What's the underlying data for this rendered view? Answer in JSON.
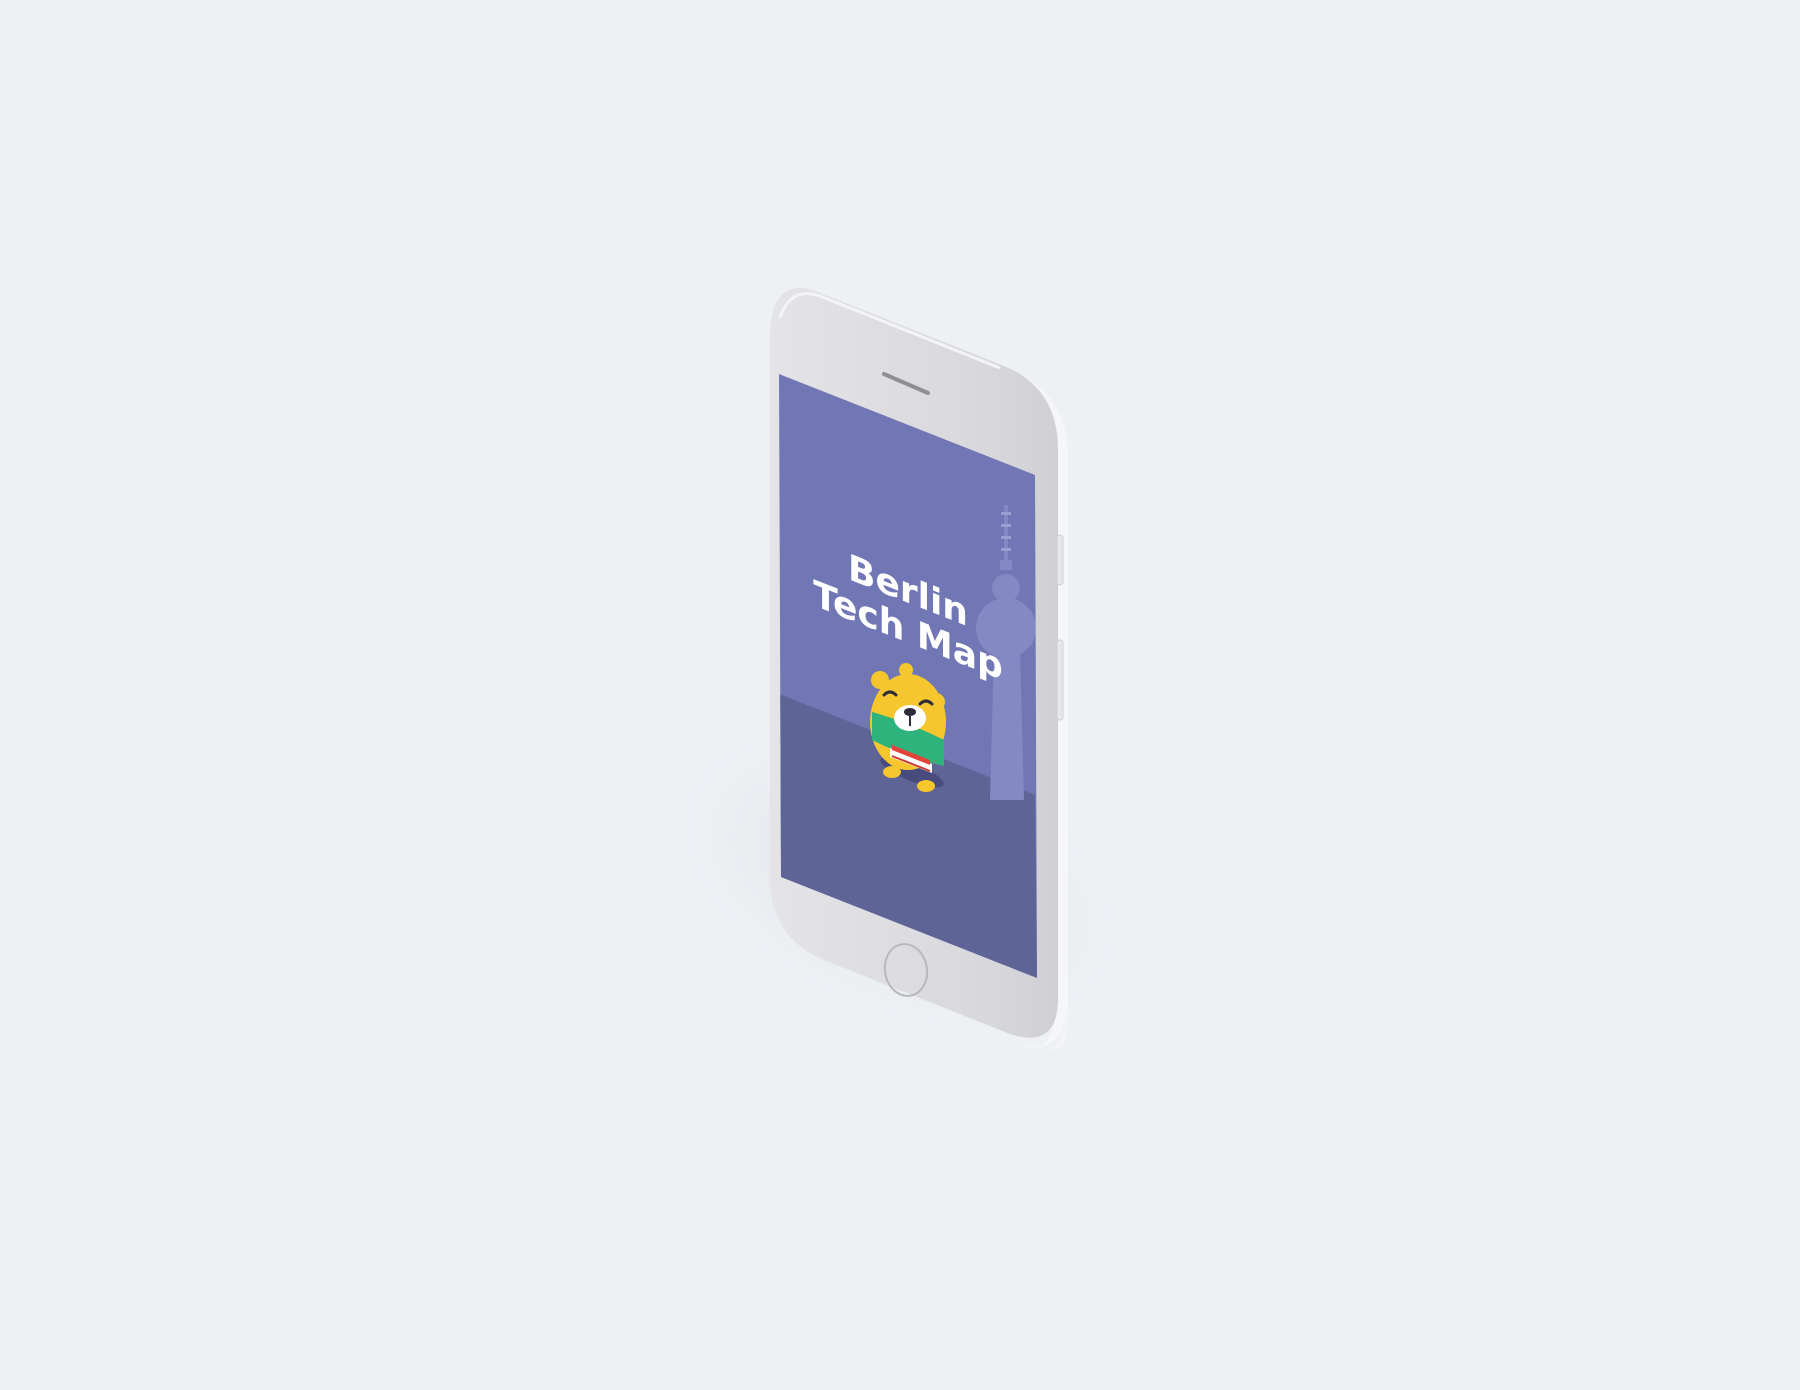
{
  "splash": {
    "title_line1": "Berlin",
    "title_line2": "Tech Map"
  },
  "colors": {
    "background": "#edf1f4",
    "phone_body": "#d9d9dd",
    "phone_edge": "#f1f1f3",
    "sky": "#7176b5",
    "ground": "#5f6496",
    "tv_tower": "#8589c3",
    "bear_yellow": "#f5c62d",
    "bear_shirt": "#2fb37c",
    "title_text": "#ffffff"
  },
  "icons": {
    "mascot": "bear-mascot-icon",
    "landmark": "berlin-tv-tower-icon",
    "home_button": "home-button-circle",
    "speaker": "earpiece-speaker"
  }
}
